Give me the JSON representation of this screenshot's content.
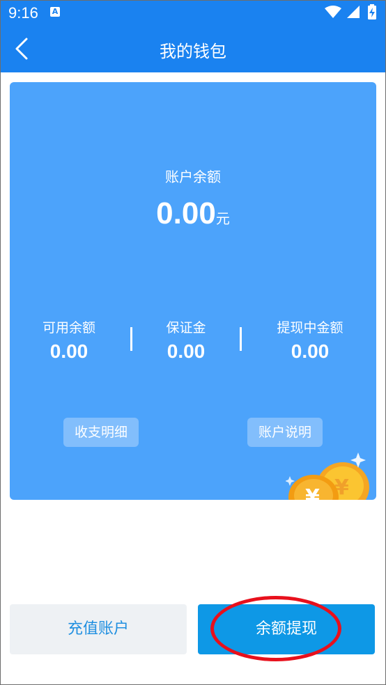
{
  "status_bar": {
    "time": "9:16",
    "notification_letter": "A",
    "icons": [
      "wifi-icon",
      "signal-icon",
      "battery-charging-icon"
    ]
  },
  "header": {
    "title": "我的钱包",
    "back_icon": "chevron-left-icon",
    "background_color": "#1a82f0"
  },
  "wallet_card": {
    "background_color": "#4ca3fb",
    "balance_label": "账户余额",
    "balance_amount": "0.00",
    "balance_unit": "元",
    "stats": [
      {
        "label": "可用余额",
        "value": "0.00"
      },
      {
        "label": "保证金",
        "value": "0.00"
      },
      {
        "label": "提现中金额",
        "value": "0.00"
      }
    ],
    "detail_button": "收支明细",
    "info_button": "账户说明",
    "decoration": "gold-coins-icon"
  },
  "actions": {
    "recharge_label": "充值账户",
    "withdraw_label": "余额提现",
    "withdraw_color": "#0e98e6",
    "highlight_color": "#e8101c"
  }
}
